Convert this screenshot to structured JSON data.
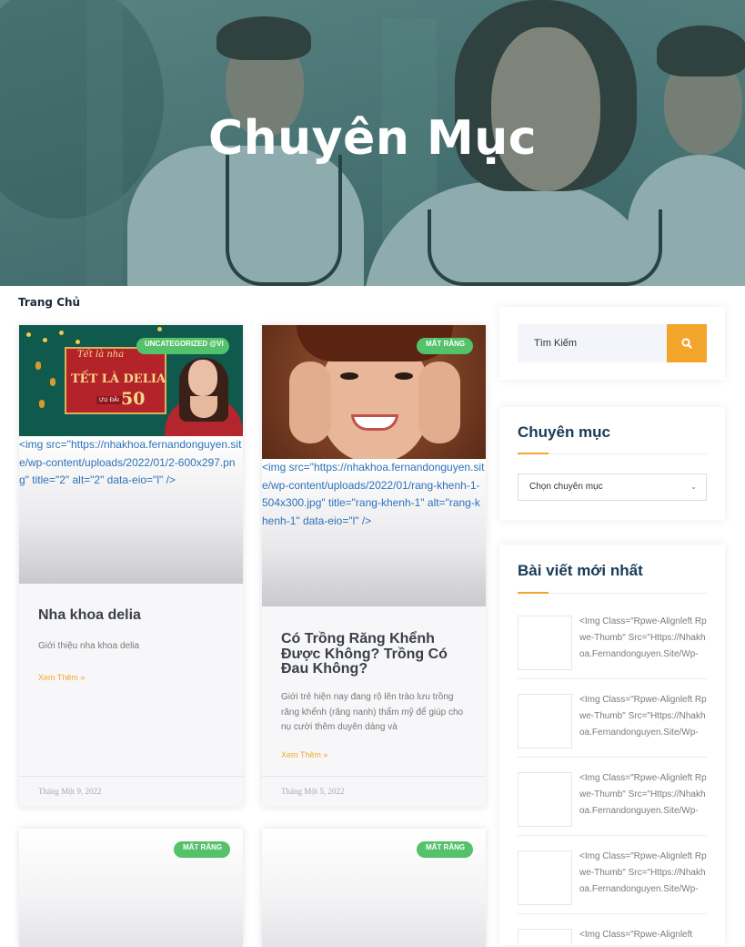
{
  "hero": {
    "title": "Chuyên Mục"
  },
  "breadcrumb": {
    "home": "Trang Chủ"
  },
  "posts": [
    {
      "badge": "UNCATEGORIZED @VI",
      "promo": {
        "script": "Tết là nha",
        "main": "TẾT LÀ DELIA",
        "sale": "ƯU ĐÃI",
        "number": "50"
      },
      "raw_img": "<img src=\"https://nhakhoa.fernandonguyen.site/wp-content/uploads/2022/01/2-600x297.png\" title=\"2\" alt=\"2\" data-eio=\"l\" />",
      "title": "Nha khoa delia",
      "excerpt": "Giới thiệu nha khoa delia",
      "more": "Xem Thêm »",
      "date": "Tháng Một 9, 2022"
    },
    {
      "badge": "MẤT RĂNG",
      "raw_img": "<img src=\"https://nhakhoa.fernandonguyen.site/wp-content/uploads/2022/01/rang-khenh-1-504x300.jpg\" title=\"rang-khenh-1\" alt=\"rang-khenh-1\" data-eio=\"l\" />",
      "title": "Có Trồng Răng Khểnh Được Không? Trồng Có Đau Không?",
      "excerpt": "Giới trẻ hiện nay đang rộ lên trào lưu trồng răng khểnh (răng nanh) thẩm mỹ để giúp cho nụ cười thêm duyên dáng và",
      "more": "Xem Thêm »",
      "date": "Tháng Một 5, 2022"
    },
    {
      "badge": "MẤT RĂNG"
    },
    {
      "badge": "MẤT RĂNG"
    }
  ],
  "sidebar": {
    "search": {
      "value": "Tìm Kiếm",
      "icon": "search-icon"
    },
    "categories": {
      "title": "Chuyên mục",
      "select_value": "Chọn chuyên mục"
    },
    "recent": {
      "title": "Bài viết mới nhất",
      "items": [
        {
          "text": "<Img Class=\"Rpwe-Alignleft Rpwe-Thumb\" Src=\"Https://Nhakhoa.Fernandonguyen.Site/Wp-"
        },
        {
          "text": "<Img Class=\"Rpwe-Alignleft Rpwe-Thumb\" Src=\"Https://Nhakhoa.Fernandonguyen.Site/Wp-"
        },
        {
          "text": "<Img Class=\"Rpwe-Alignleft Rpwe-Thumb\" Src=\"Https://Nhakhoa.Fernandonguyen.Site/Wp-"
        },
        {
          "text": "<Img Class=\"Rpwe-Alignleft Rpwe-Thumb\" Src=\"Https://Nhakhoa.Fernandonguyen.Site/Wp-"
        },
        {
          "text": "<Img Class=\"Rpwe-Alignleft"
        }
      ]
    }
  },
  "colors": {
    "accent": "#f3a52b",
    "badge": "#54c26a",
    "link": "#2d72b8",
    "heading": "#183a55"
  }
}
